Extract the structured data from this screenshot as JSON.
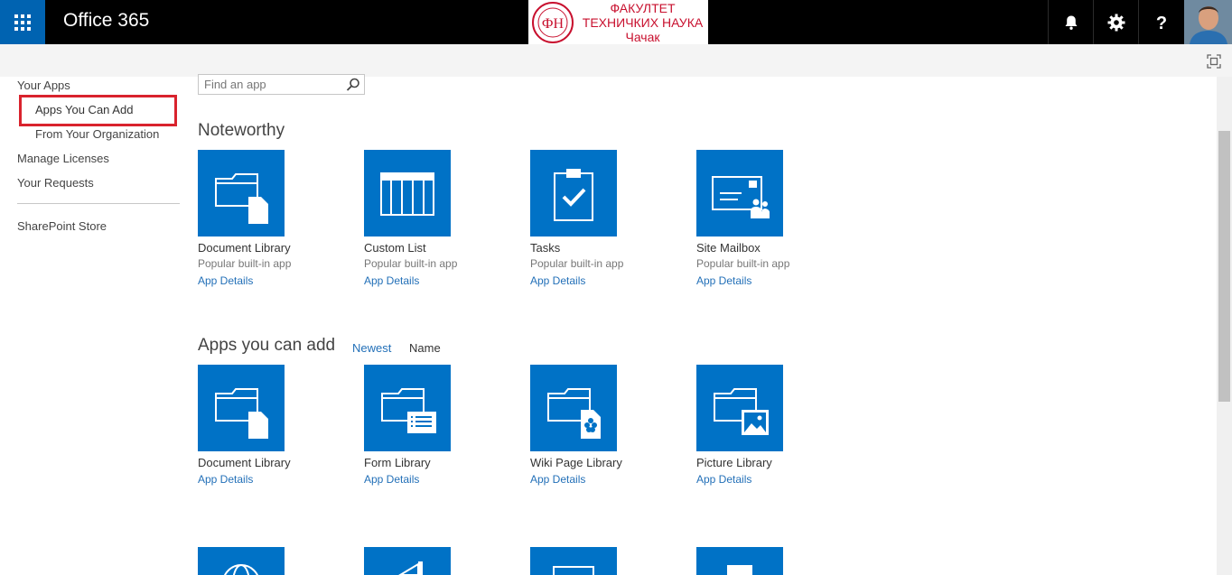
{
  "suite_bar": {
    "app_title": "Office 365",
    "logo": {
      "line1": "ФАКУЛТЕТ",
      "line2": "ТЕХНИЧКИХ НАУКА",
      "line3": "Чачак",
      "seal_letters": "ФН"
    },
    "icons": [
      "app-launcher-icon",
      "bell-icon",
      "gear-icon",
      "help-icon"
    ]
  },
  "left_nav": {
    "your_apps": "Your Apps",
    "apps_you_can_add": "Apps You Can Add",
    "from_your_organization": "From Your Organization",
    "manage_licenses": "Manage Licenses",
    "your_requests": "Your Requests",
    "sharepoint_store": "SharePoint Store"
  },
  "search": {
    "placeholder": "Find an app"
  },
  "noteworthy": {
    "title": "Noteworthy",
    "tiles": [
      {
        "name": "Document Library",
        "subtitle": "Popular built-in app",
        "details": "App Details"
      },
      {
        "name": "Custom List",
        "subtitle": "Popular built-in app",
        "details": "App Details"
      },
      {
        "name": "Tasks",
        "subtitle": "Popular built-in app",
        "details": "App Details"
      },
      {
        "name": "Site Mailbox",
        "subtitle": "Popular built-in app",
        "details": "App Details"
      }
    ]
  },
  "apps_you_can_add": {
    "title": "Apps you can add",
    "sort_newest": "Newest",
    "sort_name": "Name",
    "tiles": [
      {
        "name": "Document Library",
        "details": "App Details"
      },
      {
        "name": "Form Library",
        "details": "App Details"
      },
      {
        "name": "Wiki Page Library",
        "details": "App Details"
      },
      {
        "name": "Picture Library",
        "details": "App Details"
      }
    ]
  },
  "colors": {
    "suite_bar": "#000000",
    "app_launcher": "#0063b1",
    "tile_blue": "#0072c6",
    "link_blue": "#2370b8",
    "highlight_red": "#d9232d"
  }
}
